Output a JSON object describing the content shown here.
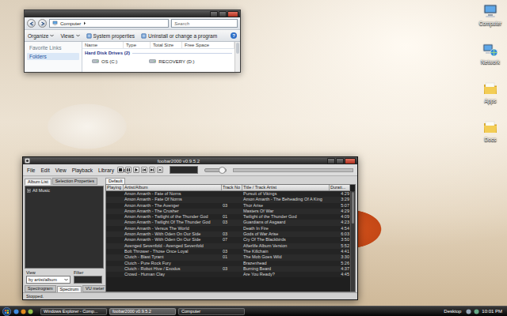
{
  "explorer": {
    "address": "Computer",
    "search": {
      "placeholder": "Search"
    },
    "toolbar": [
      {
        "label": "Organize",
        "kind": "menu"
      },
      {
        "label": "Views",
        "kind": "menu"
      },
      {
        "label": "System properties",
        "kind": "command"
      },
      {
        "label": "Uninstall or change a program",
        "kind": "command"
      }
    ],
    "help": "?",
    "nav": [
      {
        "label": "Favorite Links",
        "selected": false
      },
      {
        "label": "Folders",
        "selected": true
      }
    ],
    "columns": [
      "Name",
      "Type",
      "Total Size",
      "Free Space"
    ],
    "group": "Hard Disk Drives (2)",
    "drives": [
      {
        "label": "OS (C:)"
      },
      {
        "label": "RECOVERY (D:)"
      }
    ]
  },
  "desktop_icons": [
    {
      "label": "Computer",
      "kind": "computer"
    },
    {
      "label": "Network",
      "kind": "network"
    },
    {
      "label": "Apps",
      "kind": "folder"
    },
    {
      "label": "Docs",
      "kind": "folder"
    }
  ],
  "player": {
    "title": "foobar2000 v0.9.5.2",
    "menu": [
      "File",
      "Edit",
      "View",
      "Playback",
      "Library",
      "Help"
    ],
    "volume": {
      "level": 0.75
    },
    "seek": {
      "level": 0
    },
    "left_tabs": [
      {
        "label": "Album List",
        "selected": true
      },
      {
        "label": "Selection Properties",
        "selected": false
      }
    ],
    "tree": [
      {
        "label": "All Music",
        "expanded": false
      }
    ],
    "view": {
      "label": "View",
      "value": "by artist/album"
    },
    "filter": {
      "label": "Filter",
      "value": ""
    },
    "bottom_tabs": [
      {
        "label": "Spectrogram",
        "selected": false
      },
      {
        "label": "Spectrum",
        "selected": true
      },
      {
        "label": "VU meter",
        "selected": false
      }
    ],
    "status": "Stopped.",
    "playlist_tabs": [
      {
        "label": "Default",
        "selected": true
      }
    ],
    "columns": [
      "Playing",
      "Artist/Album",
      "Track No",
      "Title / Track Artist",
      "Durati..."
    ],
    "rows": [
      {
        "artist_album": "Amon Amarth - Fate of Norns",
        "track": "",
        "title": "Pursuit of Vikings",
        "duration": "4:29"
      },
      {
        "artist_album": "Amon Amarth - Fate Of Norns",
        "track": "",
        "title": "Amon Amarth - The Beheading Of A King",
        "duration": "3:29"
      },
      {
        "artist_album": "Amon Amarth - The Avenger",
        "track": "03",
        "title": "Thor Arise",
        "duration": "5:07"
      },
      {
        "artist_album": "Amon Amarth - The Crusher",
        "track": "",
        "title": "Masters Of War",
        "duration": "4:29"
      },
      {
        "artist_album": "Amon Amarth - Twilight of the Thunder God",
        "track": "01",
        "title": "Twilight of the Thunder God",
        "duration": "4:09"
      },
      {
        "artist_album": "Amon Amarth - Twilight Of The Thunder God",
        "track": "03",
        "title": "Guardians of Asgaard",
        "duration": "4:23"
      },
      {
        "artist_album": "Amon Amarth - Versus The World",
        "track": "",
        "title": "Death In Fire",
        "duration": "4:54"
      },
      {
        "artist_album": "Amon Amarth - With Oden On Our Side",
        "track": "03",
        "title": "Gods of War Arise",
        "duration": "6:03"
      },
      {
        "artist_album": "Amon Amarth - With Oden On Our Side",
        "track": "07",
        "title": "Cry Of The Blackbirds",
        "duration": "3:50"
      },
      {
        "artist_album": "Avenged Sevenfold - Avenged Sevenfold",
        "track": "",
        "title": "Afterlife Album Version",
        "duration": "5:52"
      },
      {
        "artist_album": "Bolt Thrower - Those Once Loyal",
        "track": "03",
        "title": "The Killchain",
        "duration": "4:41"
      },
      {
        "artist_album": "Clutch - Blast Tyrant",
        "track": "01",
        "title": "The Mob Goes Wild",
        "duration": "3:30"
      },
      {
        "artist_album": "Clutch - Pure Rock Fury",
        "track": "",
        "title": "Brazenhead",
        "duration": "5:26"
      },
      {
        "artist_album": "Clutch - Robot Hive / Exodus",
        "track": "03",
        "title": "Burning Beard",
        "duration": "4:37"
      },
      {
        "artist_album": "Crowd - Human Clay",
        "track": "",
        "title": "Are You Ready?",
        "duration": "4:45"
      }
    ]
  },
  "taskbar": {
    "tasks": [
      {
        "label": "Windows Explorer - Comp...",
        "selected": false
      },
      {
        "label": "foobar2000 v0.9.5.2",
        "selected": true
      },
      {
        "label": "Computer",
        "selected": false
      }
    ],
    "toolbar": "Desktop",
    "clock": "10:01 PM"
  }
}
